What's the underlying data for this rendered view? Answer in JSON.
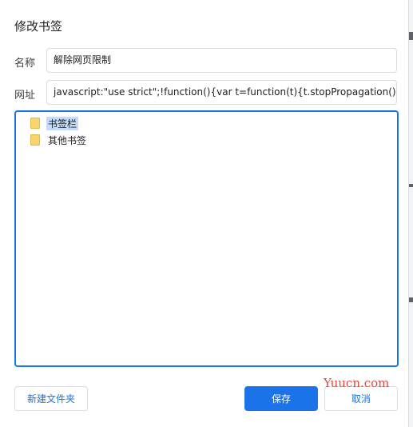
{
  "dialog": {
    "title": "修改书签",
    "name_label": "名称",
    "name_value": "解除网页限制",
    "url_label": "网址",
    "url_value": "javascript:\"use strict\";!function(){var t=function(t){t.stopPropagation(),t.stop"
  },
  "tree": {
    "items": [
      {
        "label": "书签栏",
        "selected": true
      },
      {
        "label": "其他书签",
        "selected": false
      }
    ]
  },
  "buttons": {
    "new_folder": "新建文件夹",
    "save": "保存",
    "cancel": "取消"
  },
  "watermark": "Yuucn.com",
  "colors": {
    "accent": "#1a73e8",
    "selection": "#c5dbf7",
    "folder": "#f9d66b",
    "watermark": "#e8473c"
  }
}
